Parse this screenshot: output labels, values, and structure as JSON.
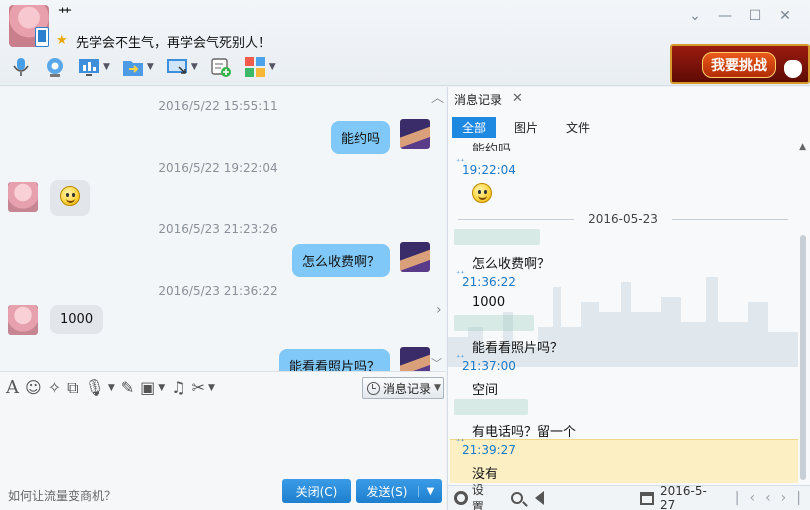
{
  "header": {
    "contact_name": "艹",
    "signature": "先学会不生气，再学会气死别人！",
    "window_buttons": [
      "minimize-dropdown",
      "minimize",
      "maximize",
      "close"
    ],
    "promo_label": "我要挑战"
  },
  "toolbar": {
    "icons": [
      "microphone-icon",
      "video-camera-icon",
      "screen-share-icon",
      "file-transfer-icon",
      "remote-desktop-icon",
      "add-app-icon",
      "apps-grid-icon"
    ]
  },
  "chat": {
    "messages": [
      {
        "time": "2016/5/22 15:55:11",
        "side": "right",
        "text": "能约吗"
      },
      {
        "time": "2016/5/22 19:22:04",
        "side": "left",
        "text": "",
        "emoji": "smiley"
      },
      {
        "time": "2016/5/23 21:23:26",
        "side": "right",
        "text": "怎么收费啊？"
      },
      {
        "time": "2016/5/23 21:36:22",
        "side": "left",
        "text": "1000"
      },
      {
        "time": "",
        "side": "right",
        "text": "能看看照片吗？"
      }
    ]
  },
  "input": {
    "history_button": "消息记录",
    "hint": "如何让流量变商机？",
    "close_button": "关闭(C)",
    "send_button": "发送(S)"
  },
  "history": {
    "tab_title": "消息记录",
    "filter_tabs": [
      "全部",
      "图片",
      "文件"
    ],
    "active_filter": "全部",
    "entries": {
      "top_partial": "能约吗",
      "t1": "19:22:04",
      "date_separator": "2016-05-23",
      "m1": "怎么收费啊？",
      "t2": "21:36:22",
      "m2": "1000",
      "m3": "能看看照片吗？",
      "t3": "21:37:00",
      "m4": "空间",
      "m5": "有电话吗？留一个",
      "t4": "21:39:27",
      "m6": "没有"
    },
    "bottom": {
      "settings_label": "设置",
      "date": "2016-5-27"
    }
  },
  "colors": {
    "accent": "#1f88e0",
    "my_bubble": "#7fc8f8",
    "peer_bubble": "#e2e6ea",
    "highlight": "#fcefc4"
  }
}
